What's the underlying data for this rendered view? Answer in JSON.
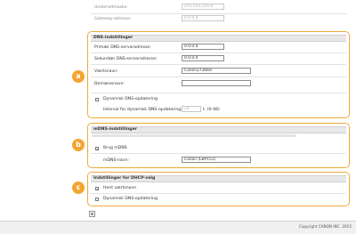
{
  "top": {
    "subnet_label": "Undernetmaske:",
    "subnet_value": "255.255.255.0",
    "gateway_label": "Gateway-adresse:",
    "gateway_value": "0.0.0.0"
  },
  "dns": {
    "title": "DNS-indstillinger",
    "primary_label": "Primær DNS-serveradresse:",
    "primary_value": "0.0.0.0",
    "secondary_label": "Sekundær DNS-serveradresse:",
    "secondary_value": "0.0.0.0",
    "host_label": "Værtsnavn:",
    "host_value": "Canon273669",
    "domain_label": "Domænenavn:",
    "domain_value": "",
    "dynamic_label": "Dynamisk DNS-opdatering",
    "interval_label": "Interval for dynamisk DNS-opdatering:",
    "interval_value": "24",
    "interval_unit": "t. (0-48)",
    "badge": "a"
  },
  "mdns": {
    "title": "mDNS-indstillinger",
    "use_label": "Brug mDNS",
    "name_label": "mDNS-navn:",
    "name_value": "Canon (LBP151)",
    "badge": "b"
  },
  "dhcp": {
    "title": "Indstillinger for DHCP-valg",
    "host_label": "Hent værtsnavn",
    "dns_label": "Dynamisk DNS-opdatering",
    "badge": "c"
  },
  "footer": {
    "copyright": "Copyright CANON INC. 2015"
  },
  "colors": {
    "accent": "#f2a531",
    "section_border": "#f0a93a"
  }
}
